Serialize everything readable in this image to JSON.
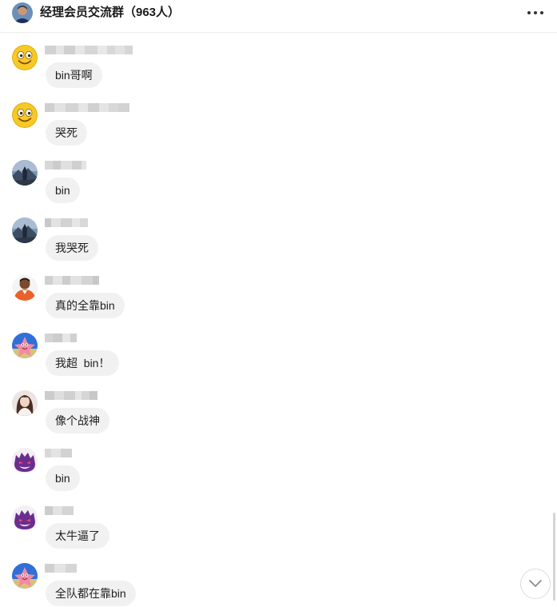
{
  "header": {
    "title": "经理会员交流群（963人）",
    "more_icon": "more-horizontal-icon"
  },
  "messages": [
    {
      "avatar": "smiley-emoji-avatar",
      "text": "bin哥啊"
    },
    {
      "avatar": "smiley-emoji-avatar",
      "text": "哭死"
    },
    {
      "avatar": "landscape-photo-avatar",
      "text": "bin"
    },
    {
      "avatar": "landscape-photo-avatar",
      "text": "我哭死"
    },
    {
      "avatar": "orange-portrait-avatar",
      "text": "真的全靠bin"
    },
    {
      "avatar": "cartoon-starfish-avatar",
      "text": "我超  bin！"
    },
    {
      "avatar": "woman-portrait-avatar",
      "text": "像个战神"
    },
    {
      "avatar": "purple-ghost-avatar",
      "text": "bin"
    },
    {
      "avatar": "purple-ghost-avatar",
      "text": "太牛逼了"
    },
    {
      "avatar": "cartoon-starfish-avatar",
      "text": "全队都在靠bin"
    }
  ],
  "scroll_down_icon": "chevron-down-icon",
  "colors": {
    "bubble": "#f1f1f1",
    "background": "#ffffff",
    "title": "#1a1a1a"
  }
}
